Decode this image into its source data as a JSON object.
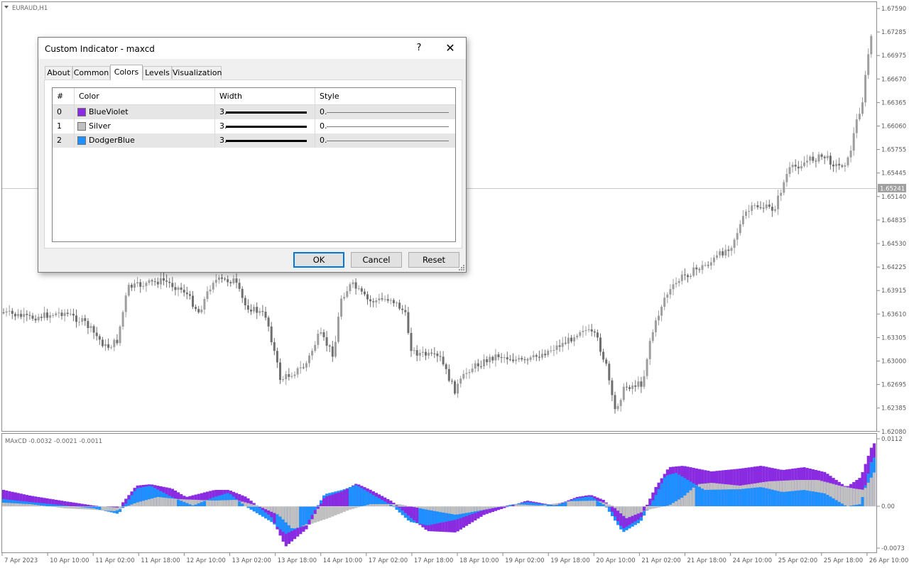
{
  "chart": {
    "symbol_label": "EURAUD,H1",
    "indicator_label": "MAxCD -0.0032 -0.0021 -0.0011",
    "price_ticks": [
      "1.67590",
      "1.67285",
      "1.66975",
      "1.66670",
      "1.66365",
      "1.66060",
      "1.65755",
      "1.65445",
      "1.65140",
      "1.64835",
      "1.64530",
      "1.64225",
      "1.63915",
      "1.63610",
      "1.63305",
      "1.63000",
      "1.62695",
      "1.62385",
      "1.62080"
    ],
    "current_price": "1.65241",
    "indicator_ticks": [
      "0.0112",
      "0.00",
      "-0.0073"
    ],
    "time_ticks": [
      "7 Apr 2023",
      "10 Apr 10:00",
      "11 Apr 02:00",
      "11 Apr 18:00",
      "12 Apr 10:00",
      "13 Apr 02:00",
      "13 Apr 18:00",
      "14 Apr 10:00",
      "17 Apr 02:00",
      "17 Apr 18:00",
      "18 Apr 10:00",
      "19 Apr 02:00",
      "19 Apr 18:00",
      "20 Apr 10:00",
      "21 Apr 02:00",
      "21 Apr 18:00",
      "24 Apr 10:00",
      "25 Apr 02:00",
      "25 Apr 18:00",
      "26 Apr 10:00"
    ],
    "colors": {
      "blue_violet": "#8a2be2",
      "silver": "#c0c0c0",
      "dodger_blue": "#1e90ff",
      "candle": "#9e9e9e",
      "candle_dark": "#6f6f6f"
    }
  },
  "dialog": {
    "title": "Custom Indicator - maxcd",
    "help": "?",
    "close": "✕",
    "tabs": [
      "About",
      "Common",
      "Colors",
      "Levels",
      "Visualization"
    ],
    "active_tab": "Colors",
    "columns": [
      "#",
      "Color",
      "Width",
      "Style"
    ],
    "rows": [
      {
        "index": "0",
        "color_name": "BlueViolet",
        "color_hex": "#8a2be2",
        "width": "3.",
        "style": "0."
      },
      {
        "index": "1",
        "color_name": "Silver",
        "color_hex": "#c0c0c0",
        "width": "3.",
        "style": "0."
      },
      {
        "index": "2",
        "color_name": "DodgerBlue",
        "color_hex": "#1e90ff",
        "width": "3.",
        "style": "0."
      }
    ],
    "buttons": {
      "ok": "OK",
      "cancel": "Cancel",
      "reset": "Reset"
    }
  }
}
